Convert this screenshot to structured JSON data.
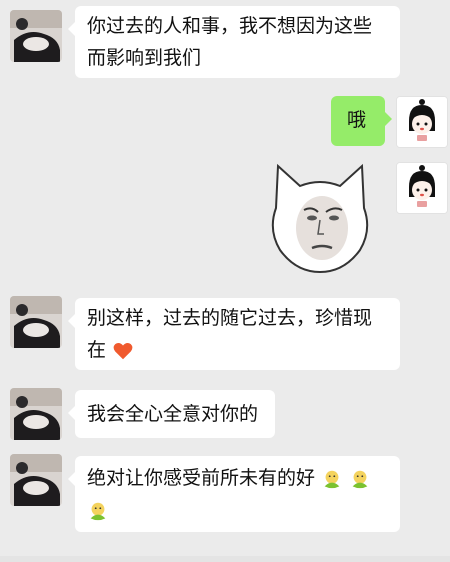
{
  "chat": {
    "messages": [
      {
        "side": "received",
        "text": "你过去的人和事，我不想因为这些而影响到我们"
      },
      {
        "side": "sent",
        "text": "哦"
      },
      {
        "side": "sent",
        "type": "sticker",
        "sticker": "panda-cat-face-meme"
      },
      {
        "side": "received",
        "text": "别这样，过去的随它过去，珍惜现在",
        "emojis": [
          "heart-emoji"
        ]
      },
      {
        "side": "received",
        "text": "我会全心全意对你的"
      },
      {
        "side": "received",
        "text": "绝对让你感受前所未有的好",
        "emojis": [
          "green-sprout-emoji",
          "green-sprout-emoji",
          "green-sprout-emoji"
        ]
      }
    ],
    "m1": {
      "line1": "你过去的人和事，我不想因为这些",
      "line2": "而影响到我们"
    },
    "m2": {
      "text": "哦"
    },
    "m4": {
      "line1": "别这样，过去的随它过去，珍惜现",
      "line2": "在"
    },
    "m5": {
      "text": "我会全心全意对你的"
    },
    "m6": {
      "line1": "绝对让你感受前所未有的好"
    },
    "colors": {
      "background": "#ebebeb",
      "received_bubble": "#ffffff",
      "sent_bubble": "#95ec69",
      "heart": "#f05a2e",
      "sprout": "#7cc230"
    }
  }
}
